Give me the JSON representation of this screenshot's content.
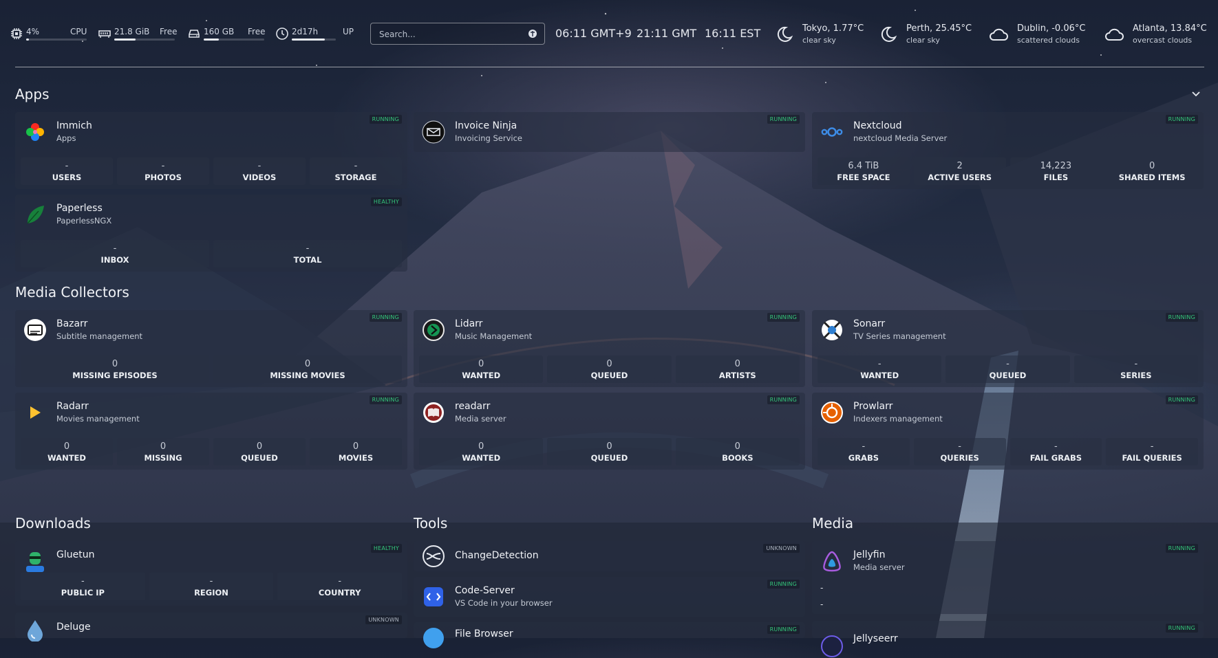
{
  "topbar": {
    "cpu": {
      "value": "4%",
      "label": "CPU",
      "fill": 0.04
    },
    "ram": {
      "value": "21.8 GiB",
      "label": "Free",
      "fill": 0.35
    },
    "disk": {
      "value": "160 GB",
      "label": "Free",
      "fill": 0.25
    },
    "uptime": {
      "value": "2d17h",
      "label": "UP",
      "fill": 0.75
    },
    "search": {
      "placeholder": "Search..."
    },
    "clocks": [
      "06:11 GMT+9",
      "21:11 GMT",
      "16:11 EST"
    ],
    "weather": [
      {
        "city": "Tokyo, 1.77°C",
        "desc": "clear sky",
        "icon": "moon-icon"
      },
      {
        "city": "Perth, 25.45°C",
        "desc": "clear sky",
        "icon": "moon-icon"
      },
      {
        "city": "Dublin, -0.06°C",
        "desc": "scattered clouds",
        "icon": "cloud-icon"
      },
      {
        "city": "Atlanta, 13.84°C",
        "desc": "overcast clouds",
        "icon": "cloud-icon"
      }
    ]
  },
  "sections": {
    "apps": "Apps",
    "media_collectors": "Media Collectors",
    "downloads": "Downloads",
    "tools": "Tools",
    "media": "Media"
  },
  "cards": {
    "immich": {
      "name": "Immich",
      "sub": "Apps",
      "status": "RUNNING",
      "stats": [
        {
          "v": "-",
          "l": "USERS"
        },
        {
          "v": "-",
          "l": "PHOTOS"
        },
        {
          "v": "-",
          "l": "VIDEOS"
        },
        {
          "v": "-",
          "l": "STORAGE"
        }
      ]
    },
    "invoice_ninja": {
      "name": "Invoice Ninja",
      "sub": "Invoicing Service",
      "status": "RUNNING"
    },
    "nextcloud": {
      "name": "Nextcloud",
      "sub": "nextcloud Media Server",
      "status": "RUNNING",
      "stats": [
        {
          "v": "6.4 TiB",
          "l": "FREE SPACE"
        },
        {
          "v": "2",
          "l": "ACTIVE USERS"
        },
        {
          "v": "14,223",
          "l": "FILES"
        },
        {
          "v": "0",
          "l": "SHARED ITEMS"
        }
      ]
    },
    "paperless": {
      "name": "Paperless",
      "sub": "PaperlessNGX",
      "status": "HEALTHY",
      "stats": [
        {
          "v": "-",
          "l": "INBOX"
        },
        {
          "v": "-",
          "l": "TOTAL"
        }
      ]
    },
    "bazarr": {
      "name": "Bazarr",
      "sub": "Subtitle management",
      "status": "RUNNING",
      "stats": [
        {
          "v": "0",
          "l": "MISSING EPISODES"
        },
        {
          "v": "0",
          "l": "MISSING MOVIES"
        }
      ]
    },
    "lidarr": {
      "name": "Lidarr",
      "sub": "Music Management",
      "status": "RUNNING",
      "stats": [
        {
          "v": "0",
          "l": "WANTED"
        },
        {
          "v": "0",
          "l": "QUEUED"
        },
        {
          "v": "0",
          "l": "ARTISTS"
        }
      ]
    },
    "sonarr": {
      "name": "Sonarr",
      "sub": "TV Series management",
      "status": "RUNNING",
      "stats": [
        {
          "v": "-",
          "l": "WANTED"
        },
        {
          "v": "-",
          "l": "QUEUED"
        },
        {
          "v": "-",
          "l": "SERIES"
        }
      ]
    },
    "radarr": {
      "name": "Radarr",
      "sub": "Movies management",
      "status": "RUNNING",
      "stats": [
        {
          "v": "0",
          "l": "WANTED"
        },
        {
          "v": "0",
          "l": "MISSING"
        },
        {
          "v": "0",
          "l": "QUEUED"
        },
        {
          "v": "0",
          "l": "MOVIES"
        }
      ]
    },
    "readarr": {
      "name": "readarr",
      "sub": "Media server",
      "status": "RUNNING",
      "stats": [
        {
          "v": "0",
          "l": "WANTED"
        },
        {
          "v": "0",
          "l": "QUEUED"
        },
        {
          "v": "0",
          "l": "BOOKS"
        }
      ]
    },
    "prowlarr": {
      "name": "Prowlarr",
      "sub": "Indexers management",
      "status": "RUNNING",
      "stats": [
        {
          "v": "-",
          "l": "GRABS"
        },
        {
          "v": "-",
          "l": "QUERIES"
        },
        {
          "v": "-",
          "l": "FAIL GRABS"
        },
        {
          "v": "-",
          "l": "FAIL QUERIES"
        }
      ]
    },
    "gluetun": {
      "name": "Gluetun",
      "status": "HEALTHY",
      "stats": [
        {
          "v": "-",
          "l": "PUBLIC IP"
        },
        {
          "v": "-",
          "l": "REGION"
        },
        {
          "v": "-",
          "l": "COUNTRY"
        }
      ]
    },
    "deluge": {
      "name": "Deluge",
      "status": "UNKNOWN"
    },
    "changedetection": {
      "name": "ChangeDetection",
      "status": "UNKNOWN"
    },
    "code_server": {
      "name": "Code-Server",
      "sub": "VS Code in your browser",
      "status": "RUNNING"
    },
    "file_browser": {
      "name": "File Browser",
      "status": "RUNNING"
    },
    "jellyfin": {
      "name": "Jellyfin",
      "sub": "Media server",
      "status": "RUNNING",
      "lines": [
        "-",
        "-"
      ]
    },
    "jellyseerr": {
      "name": "Jellyseerr",
      "status": "RUNNING"
    }
  },
  "colors": {
    "status_ok": "#34c77b",
    "status_unknown": "#aab2be"
  }
}
